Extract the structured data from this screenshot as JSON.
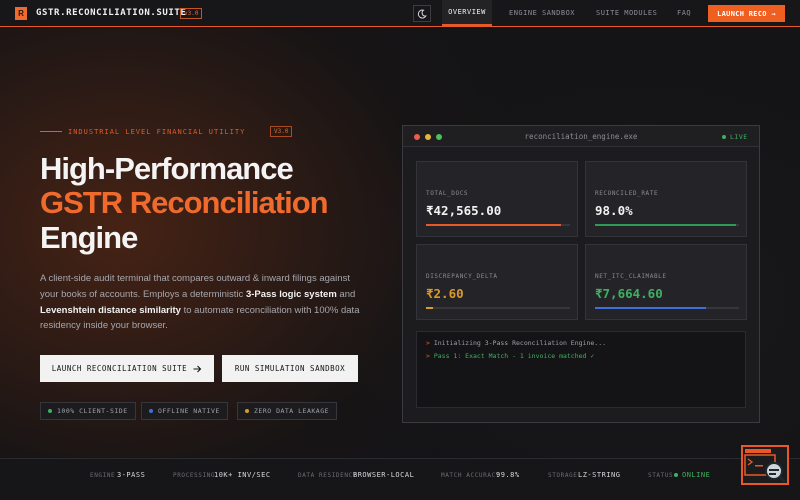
{
  "nav": {
    "logo_letter": "R",
    "brand": "GSTR.RECONCILIATION.SUITE",
    "version": "v3.0",
    "theme_icon": "moon-icon",
    "links": [
      "OVERVIEW",
      "ENGINE SANDBOX",
      "SUITE MODULES",
      "FAQ"
    ],
    "active_link": "OVERVIEW",
    "launch_label": "LAUNCH RECO →"
  },
  "hero": {
    "tagline": "INDUSTRIAL LEVEL FINANCIAL UTILITY",
    "tag_version": "V3.0",
    "title_line1": "High-Performance",
    "title_line2": "GSTR Reconciliation",
    "title_line3": "Engine",
    "desc_1": "A client-side audit terminal that compares outward & inward filings against your books of accounts. Employs a deterministic ",
    "desc_b1": "3-Pass logic system",
    "desc_2": " and ",
    "desc_b2": "Levenshtein distance similarity",
    "desc_3": " to automate reconciliation with 100% data residency inside your browser.",
    "primary_cta": "LAUNCH RECONCILIATION SUITE",
    "secondary_cta": "RUN SIMULATION SANDBOX",
    "badges": [
      {
        "label": "100% CLIENT-SIDE",
        "color": "#3fb060"
      },
      {
        "label": "OFFLINE NATIVE",
        "color": "#3d6fd8"
      },
      {
        "label": "ZERO DATA LEAKAGE",
        "color": "#d89a2a"
      }
    ]
  },
  "terminal": {
    "title": "reconciliation_engine.exe",
    "status": "LIVE",
    "cards": [
      {
        "label": "TOTAL_DOCS",
        "value": "₹42,565.00",
        "color": "#f2f2f2",
        "bar_color": "#e8592a",
        "progress": 0.94
      },
      {
        "label": "RECONCILED_RATE",
        "value": "98.0%",
        "color": "#f2f2f2",
        "bar_color": "#2f9a55",
        "progress": 0.98
      },
      {
        "label": "DISCREPANCY_DELTA",
        "value": "₹2.60",
        "color": "#d89a2a",
        "bar_color": "#d89a2a",
        "progress": 0.05
      },
      {
        "label": "NET_ITC_CLAIMABLE",
        "value": "₹7,664.60",
        "color": "#3fb060",
        "bar_color": "#3d6fd8",
        "progress": 0.77
      }
    ],
    "log": [
      {
        "prompt": ">",
        "text": "Initializing 3-Pass Reconciliation Engine...",
        "color": "#a0a0a8"
      },
      {
        "prompt": ">",
        "text": "Pass 1: Exact Match - 1 invoice matched ✓",
        "color": "#3fb060"
      }
    ]
  },
  "footer": {
    "stats": [
      {
        "key": "ENGINE",
        "value": "3-PASS"
      },
      {
        "key": "PROCESSING",
        "value": "10K+ INV/SEC"
      },
      {
        "key": "DATA RESIDENCY",
        "value": "BROWSER-LOCAL"
      },
      {
        "key": "MATCH ACCURACY",
        "value": "99.8%"
      },
      {
        "key": "STORAGE",
        "value": "LZ-STRING"
      },
      {
        "key": "STATUS",
        "value": "ONLINE"
      }
    ],
    "widget_icon": "terminal-search-icon"
  },
  "colors": {
    "accent": "#e8592a",
    "bg": "#141416",
    "online": "#3fb060"
  }
}
